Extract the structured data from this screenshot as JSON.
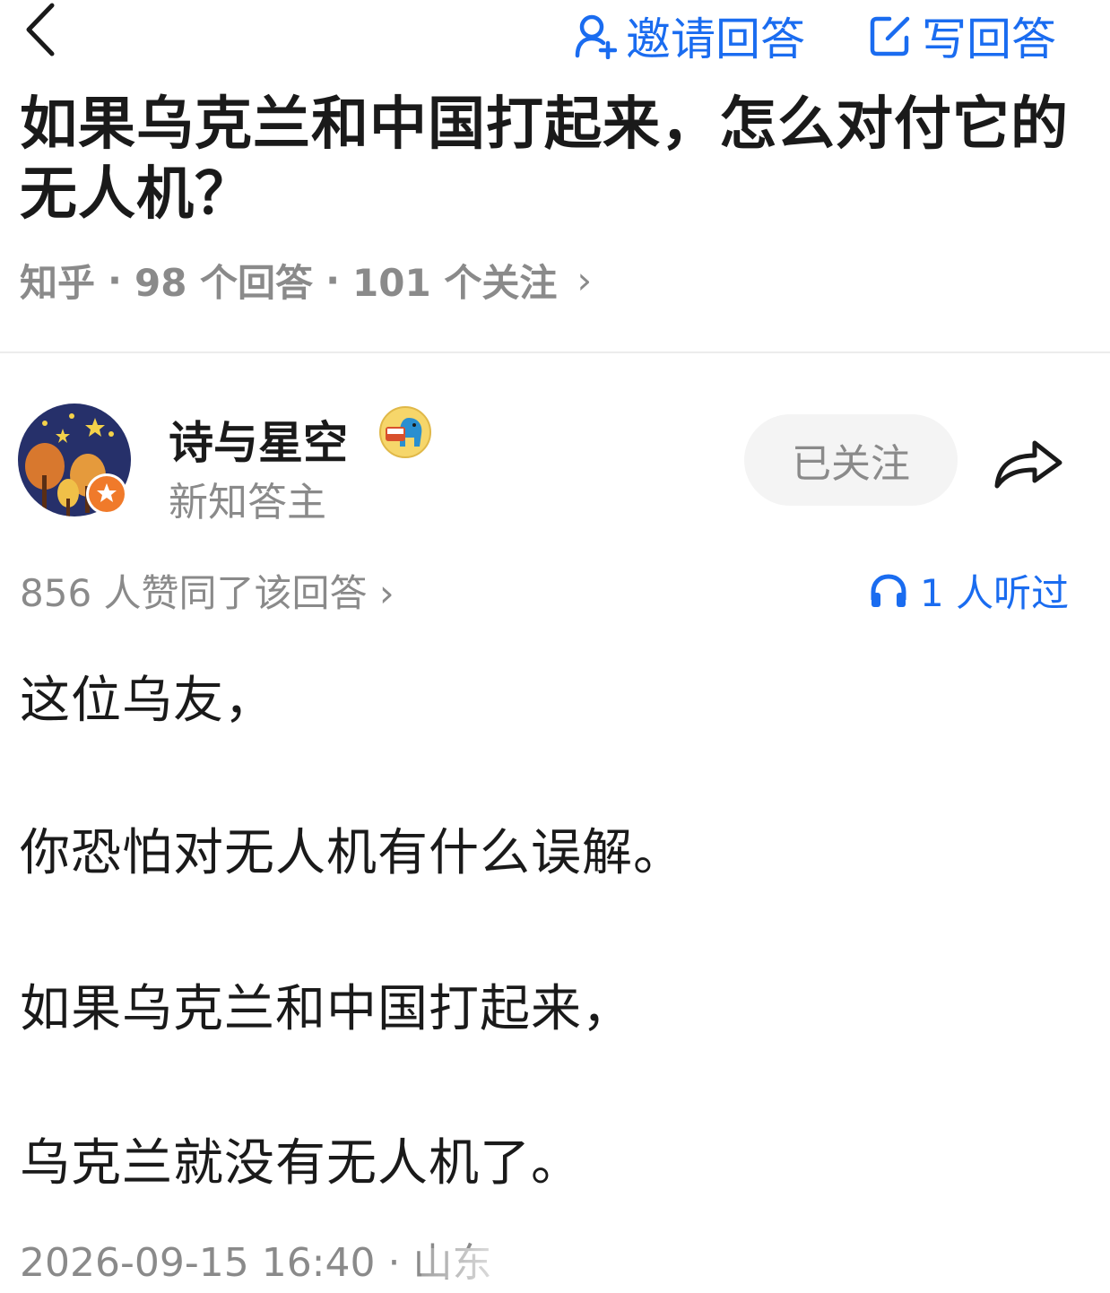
{
  "header": {
    "invite_label": "邀请回答",
    "write_label": "写回答"
  },
  "question": {
    "title": "如果乌克兰和中国打起来，怎么对付它的无人机？",
    "source": "知乎",
    "answers_count": "98 个回答",
    "followers_count": "101 个关注",
    "chevron": "›"
  },
  "author": {
    "name": "诗与星空",
    "subtitle": "新知答主",
    "follow_label": "已关注"
  },
  "stats": {
    "upvotes": "856 人赞同了该回答 ›",
    "listened": "1 人听过"
  },
  "answer": {
    "paragraphs": [
      "这位乌友，",
      "你恐怕对无人机有什么误解。",
      "如果乌克兰和中国打起来，",
      "乌克兰就没有无人机了。"
    ]
  },
  "footer": {
    "timestamp": "2026-09-15 16:40 · 山东"
  },
  "icons": {
    "back": "chevron-left-icon",
    "invite": "person-add-icon",
    "write": "edit-icon",
    "share": "share-arrow-icon",
    "listen": "headphones-icon",
    "verified": "star-badge-icon"
  },
  "colors": {
    "accent": "#1a6cf0",
    "muted": "#8a8a8a",
    "follow_bg": "#f4f4f4",
    "badge": "#f07a2a"
  }
}
